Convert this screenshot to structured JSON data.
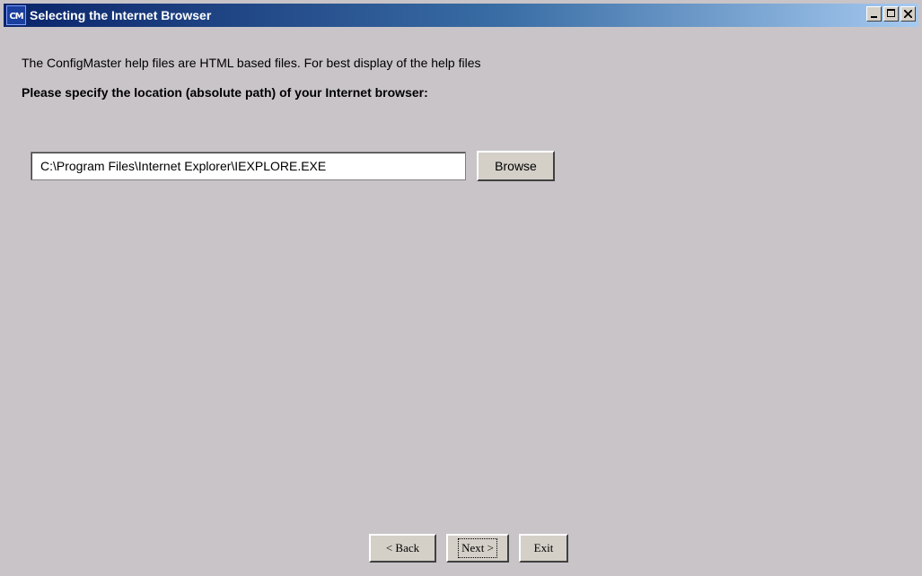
{
  "window": {
    "title": "Selecting the Internet Browser",
    "icon": "CM"
  },
  "content": {
    "intro_text": "The ConfigMaster help files are HTML based files. For best display of the help files",
    "prompt_text": "Please specify the location (absolute path) of your Internet browser:",
    "browser_path": "C:\\Program Files\\Internet Explorer\\IEXPLORE.EXE",
    "browse_label": "Browse"
  },
  "footer": {
    "back_label": "< Back",
    "next_label": "Next >",
    "exit_label": "Exit"
  },
  "colors": {
    "background": "#c8c4c8",
    "titlebar_start": "#0a246a",
    "titlebar_end": "#a6caf0"
  }
}
